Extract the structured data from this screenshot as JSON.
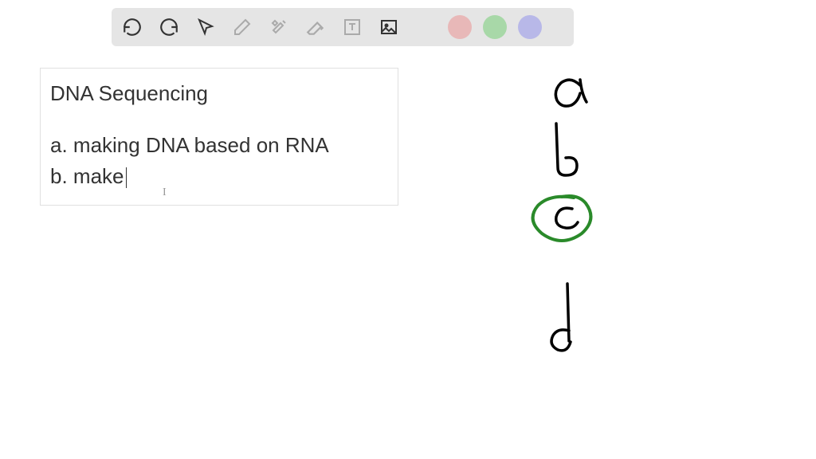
{
  "toolbar": {
    "colors": {
      "black": "#000000",
      "pink": "#e8b8b8",
      "green": "#a8d8a8",
      "purple": "#b8b8e8"
    }
  },
  "textbox": {
    "title": "DNA Sequencing",
    "line_a": "a. making DNA based on RNA",
    "line_b_prefix": "b. make"
  },
  "handwriting": {
    "letters": [
      "a",
      "b",
      "c",
      "d"
    ],
    "circled": "c",
    "circle_color": "#2a8a2a"
  }
}
